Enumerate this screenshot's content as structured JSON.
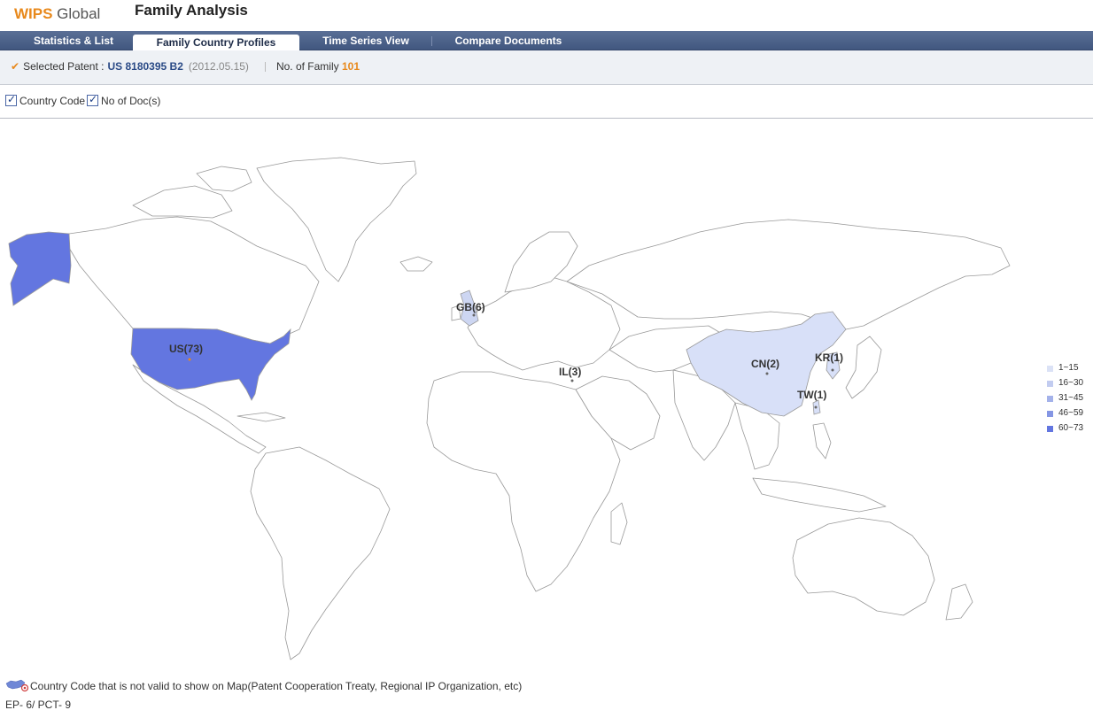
{
  "header": {
    "logo": {
      "w": "W",
      "ips": "IPS",
      "global": " Global"
    },
    "title": "Family Analysis"
  },
  "tabs": [
    {
      "label": "Statistics & List",
      "active": false
    },
    {
      "label": "Family Country Profiles",
      "active": true
    },
    {
      "label": "Time Series View",
      "active": false
    },
    {
      "label": "Compare Documents",
      "active": false
    }
  ],
  "info": {
    "selected_label": "Selected Patent :",
    "patent_number": "US 8180395 B2",
    "patent_date": "(2012.05.15)",
    "family_label": "No. of Family",
    "family_count": "101"
  },
  "options": {
    "country_code": {
      "label": "Country Code",
      "checked": true
    },
    "num_docs": {
      "label": "No of Doc(s)",
      "checked": true
    }
  },
  "map": {
    "countries": [
      {
        "code": "US",
        "label": "US(73)",
        "docs": 73,
        "color": "#6376e0"
      },
      {
        "code": "GB",
        "label": "GB(6)",
        "docs": 6,
        "color": "#cdd6f2"
      },
      {
        "code": "IL",
        "label": "IL(3)",
        "docs": 3,
        "color": "#ffffff"
      },
      {
        "code": "CN",
        "label": "CN(2)",
        "docs": 2,
        "color": "#d8e0f8"
      },
      {
        "code": "KR",
        "label": "KR(1)",
        "docs": 1,
        "color": "#d8e0f8"
      },
      {
        "code": "TW",
        "label": "TW(1)",
        "docs": 1,
        "color": "#d8e0f8"
      }
    ]
  },
  "legend": [
    {
      "label": "1~15",
      "color": "#dbe2f6"
    },
    {
      "label": "16~30",
      "color": "#c2ccf0"
    },
    {
      "label": "31~45",
      "color": "#a4b2ea"
    },
    {
      "label": "46~59",
      "color": "#8596e4"
    },
    {
      "label": "60~73",
      "color": "#6376e0"
    }
  ],
  "footer": {
    "note": "Country Code that is not valid to show on Map(Patent Cooperation Treaty, Regional IP Organization, etc)",
    "ep_pct": "EP- 6/ PCT- 9"
  }
}
